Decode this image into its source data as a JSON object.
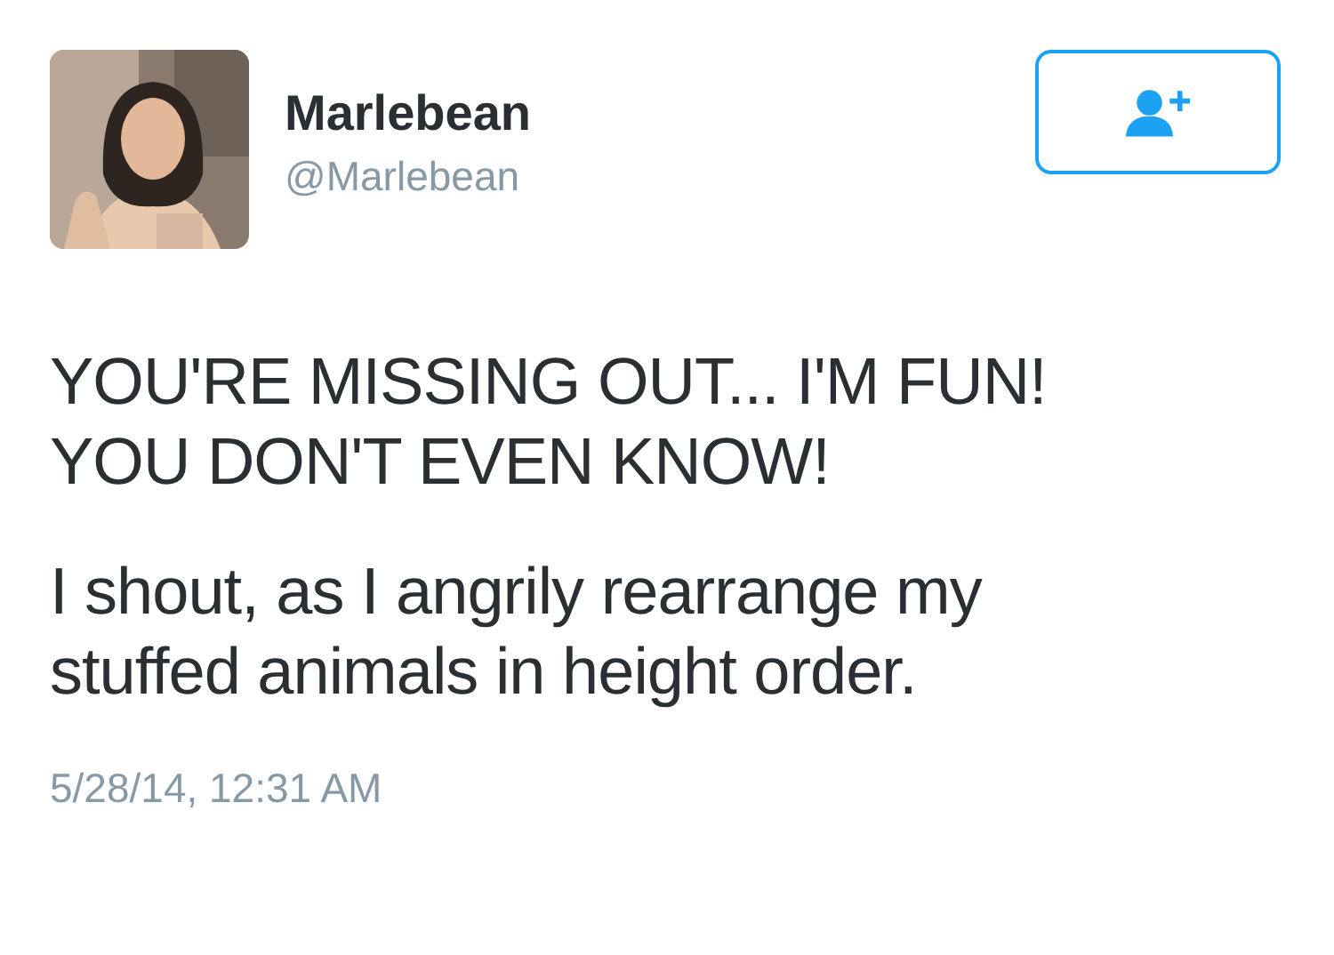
{
  "author": {
    "name": "Marlebean",
    "handle": "@Marlebean"
  },
  "tweet": {
    "paragraphs": [
      "YOU'RE MISSING OUT... I'M FUN!\nYOU DON'T EVEN KNOW!",
      "I shout, as I angrily rearrange my\nstuffed animals in height order."
    ],
    "timestamp": "5/28/14, 12:31 AM"
  }
}
